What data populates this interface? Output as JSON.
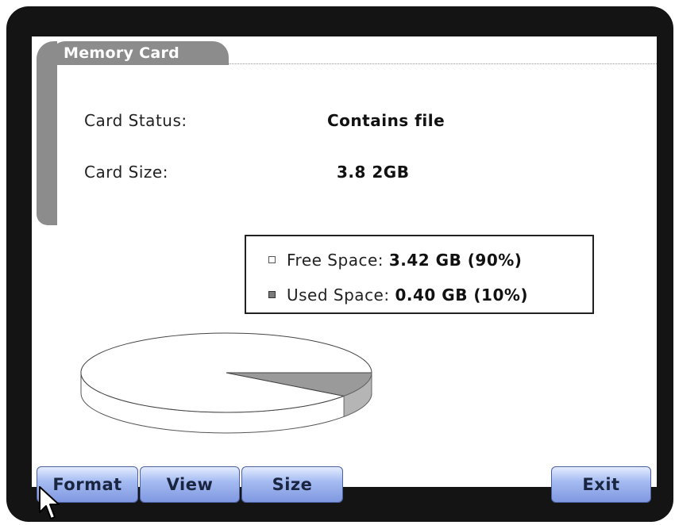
{
  "panel": {
    "title": "Memory Card"
  },
  "fields": {
    "status_label": "Card Status:",
    "status_value": "Contains file",
    "size_label": "Card Size:",
    "size_value": "3.8 2GB"
  },
  "legend": {
    "free_label": "Free Space:",
    "free_value": "3.42 GB (90%)",
    "used_label": "Used Space:",
    "used_value": "0.40 GB (10%)"
  },
  "chart_data": {
    "type": "pie",
    "categories": [
      "Free Space",
      "Used Space"
    ],
    "values": [
      90,
      10
    ],
    "colors": [
      "#ffffff",
      "#9a9a9a"
    ]
  },
  "buttons": {
    "format": "Format",
    "view": "View",
    "size": "Size",
    "exit": "Exit"
  },
  "icons": {
    "cursor": "mouse-pointer-icon"
  }
}
